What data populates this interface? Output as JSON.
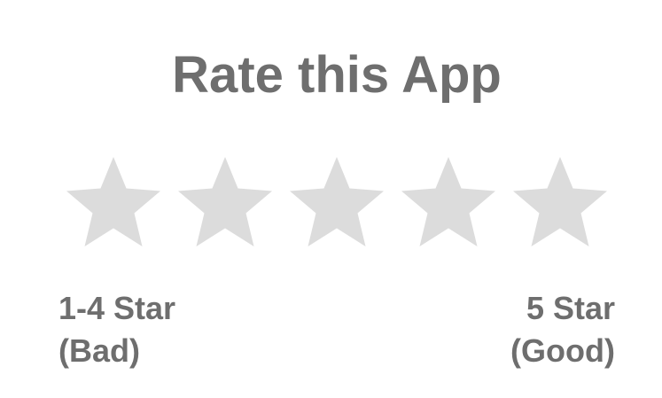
{
  "dialog": {
    "title": "Rate this App"
  },
  "rating": {
    "max_stars": 5,
    "selected_stars": 0,
    "star_color": "#dcdcdc",
    "left_label_line1": "1-4 Star",
    "left_label_line2": "(Bad)",
    "right_label_line1": "5 Star",
    "right_label_line2": "(Good)"
  },
  "colors": {
    "text": "#6e6e6e",
    "background": "#ffffff"
  }
}
